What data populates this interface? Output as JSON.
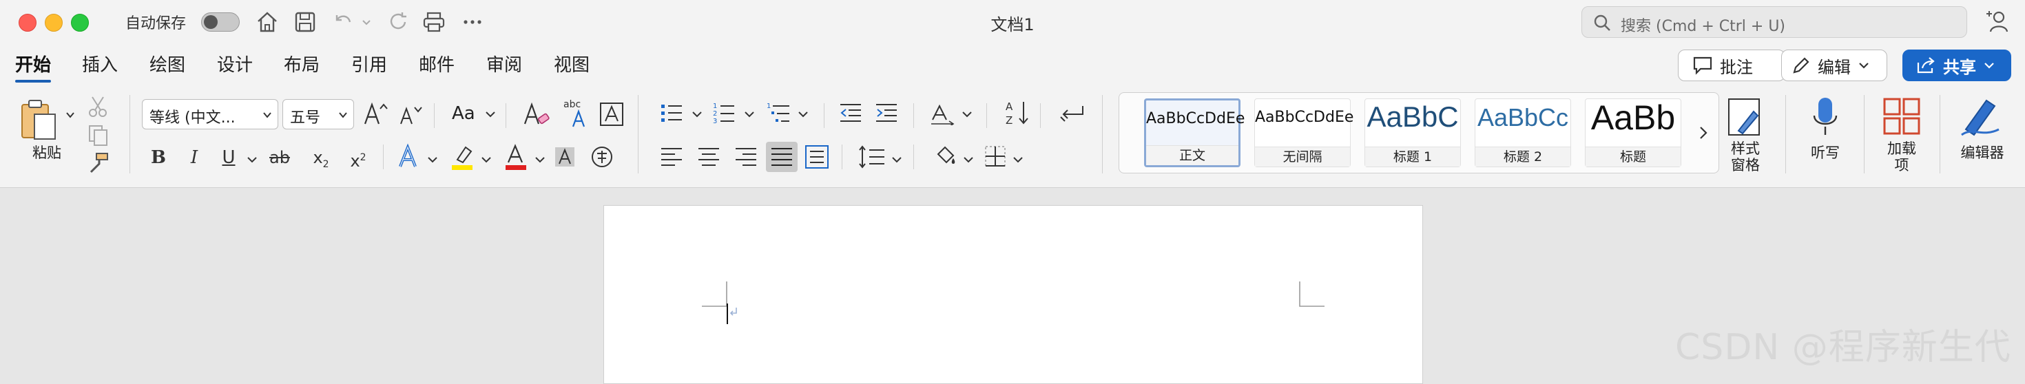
{
  "titlebar": {
    "autosave_label": "自动保存",
    "autosave_on": false,
    "document_title": "文档1",
    "search_placeholder": "搜索 (Cmd + Ctrl + U)"
  },
  "tabs": [
    {
      "label": "开始",
      "active": true
    },
    {
      "label": "插入"
    },
    {
      "label": "绘图"
    },
    {
      "label": "设计"
    },
    {
      "label": "布局"
    },
    {
      "label": "引用"
    },
    {
      "label": "邮件"
    },
    {
      "label": "审阅"
    },
    {
      "label": "视图"
    }
  ],
  "actions": {
    "comments_label": "批注",
    "editing_label": "编辑",
    "share_label": "共享"
  },
  "ribbon": {
    "paste_label": "粘贴",
    "font_name": "等线 (中文...",
    "font_size": "五号",
    "change_case_label": "Aa",
    "styles": [
      {
        "sample": "AaBbCcDdEe",
        "name": "正文",
        "selected": true
      },
      {
        "sample": "AaBbCcDdEe",
        "name": "无间隔"
      },
      {
        "sample": "AaBbC",
        "name": "标题 1"
      },
      {
        "sample": "AaBbCc",
        "name": "标题 2"
      },
      {
        "sample": "AaBb",
        "name": "标题"
      }
    ],
    "styles_pane_label": "样式\n窗格",
    "dictate_label": "听写",
    "addins_label": "加载\n项",
    "editor_label": "编辑器"
  },
  "colors": {
    "accent": "#1a67c8",
    "highlight": "#ffe600",
    "font_color": "#e02020"
  },
  "watermark": "CSDN @程序新生代"
}
